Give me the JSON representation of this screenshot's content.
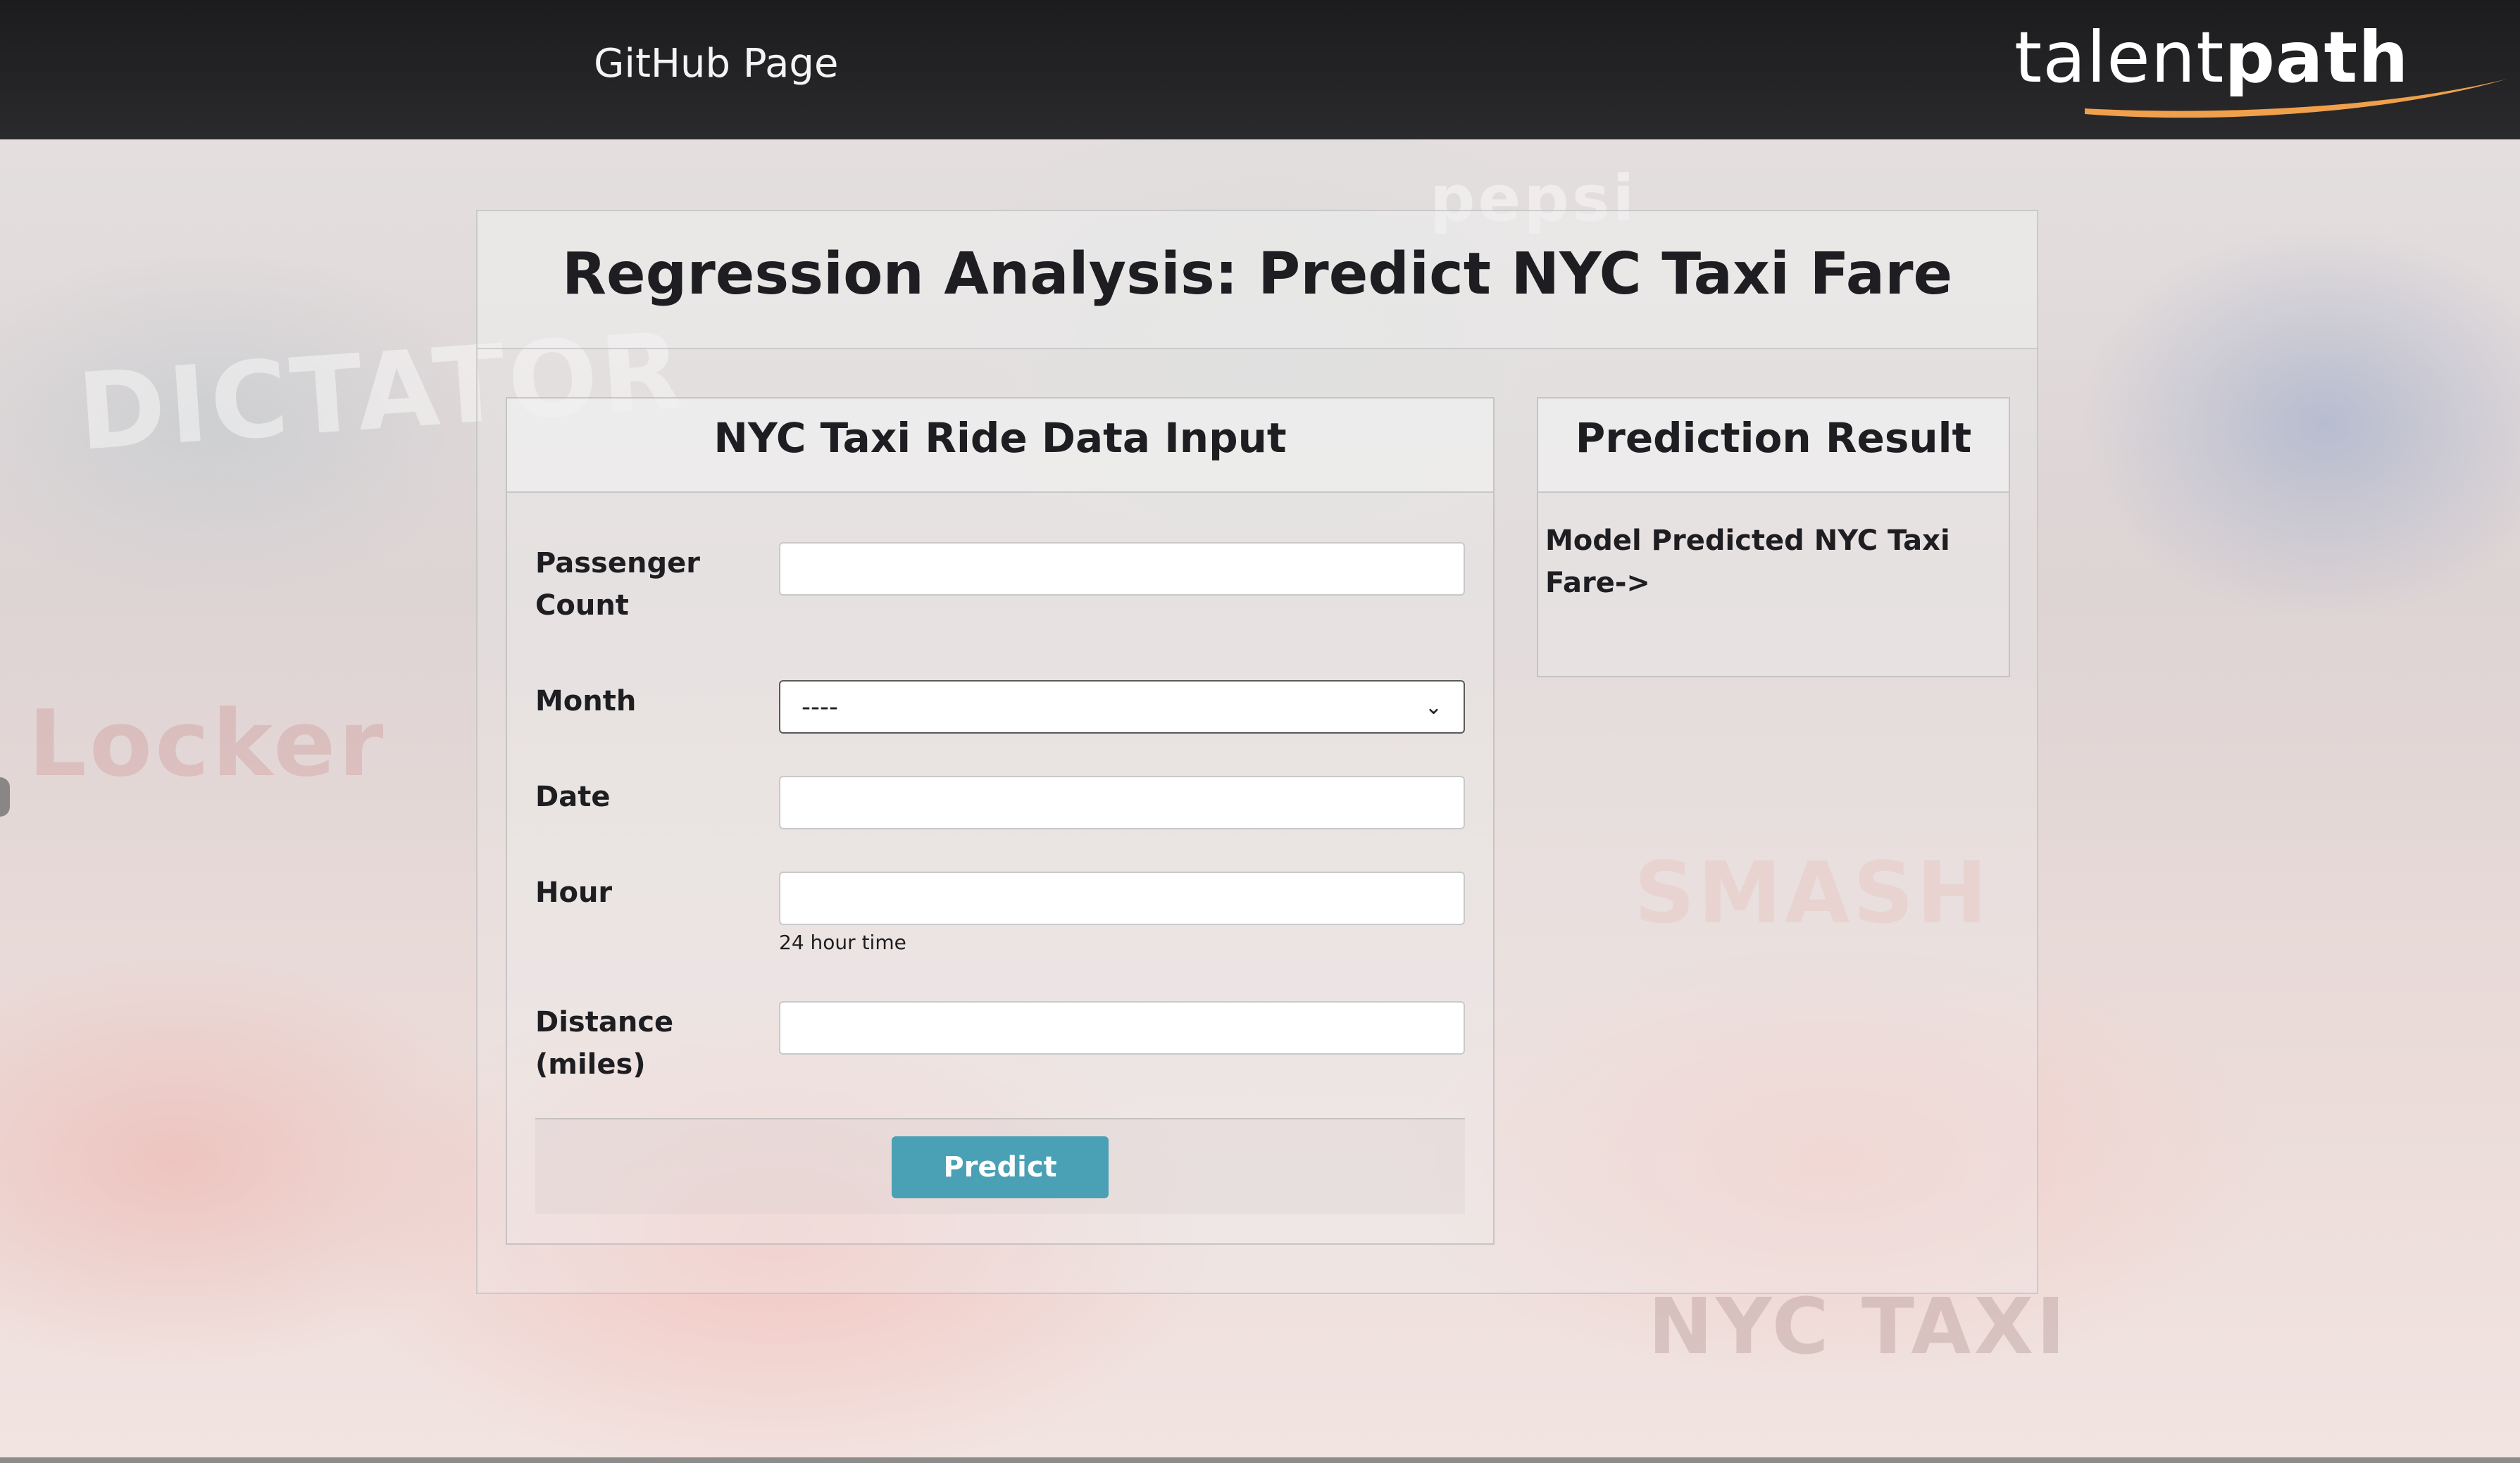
{
  "header": {
    "github_link": "GitHub Page",
    "logo": {
      "light": "talent",
      "bold": "path"
    }
  },
  "page": {
    "title": "Regression Analysis: Predict NYC Taxi Fare"
  },
  "input_card": {
    "title": "NYC Taxi Ride Data Input",
    "fields": [
      {
        "label_line1": "Passenger",
        "label_line2": "Count",
        "value": ""
      },
      {
        "label_line1": "Month",
        "selected": "----"
      },
      {
        "label_line1": "Date",
        "value": ""
      },
      {
        "label_line1": "Hour",
        "value": "",
        "help": "24 hour time"
      },
      {
        "label_line1": "Distance",
        "label_line2": "(miles)",
        "value": ""
      }
    ],
    "submit_label": "Predict"
  },
  "result_card": {
    "title": "Prediction Result",
    "text_line1": "Model Predicted NYC Taxi",
    "text_line2": "Fare->"
  },
  "colors": {
    "topbar": "#1c1c1e",
    "button": "#4aa0b5",
    "logo_swoosh": "#f0a04b"
  },
  "background_signs": [
    "DICTATOR",
    "Locker",
    "NYC TAXI",
    "SMASH",
    "pepsi"
  ]
}
